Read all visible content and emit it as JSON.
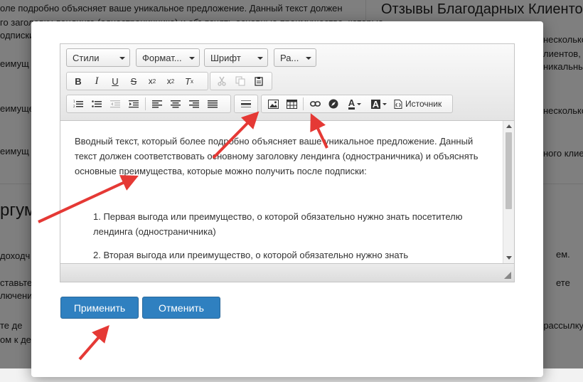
{
  "background": {
    "left_lines": [
      "оле подробно объясняет ваше уникальное предложение. Данный текст должен",
      "го заголовку лендинга (одностраничника) и объяснять основные преимущества, которые",
      "одписки:",
      "еимущ",
      "еимуще",
      "еимущ"
    ],
    "right_heading": "Отзывы Благодарных Клиенто",
    "right_lines": [
      "несколько",
      "лиентов,",
      "никальным",
      "несколько",
      "ного клиен"
    ],
    "left_big": "ргум",
    "lower_left_lines": [
      "доходч",
      "ставьте ч",
      "лючение",
      "те де",
      "ом к де"
    ],
    "lower_right_lines": [
      "ем.",
      "ете",
      "-рассылку"
    ]
  },
  "editor": {
    "toolbar": {
      "combos": [
        "Стили",
        "Формат...",
        "Шрифт",
        "Ра..."
      ],
      "source_label": "Источник"
    },
    "content": {
      "intro": "Вводный текст, который более подробно объясняет ваше уникальное предложение. Данный текст должен соответствовать основному заголовку лендинга (одностраничника) и объяснять основные преимущества, которые можно получить после подписки:",
      "list": [
        "1. Первая выгода или преимущество, о которой обязательно нужно знать посетителю лендинга (одностраничника)",
        "2. Вторая выгода или преимущество, о которой обязательно нужно знать"
      ]
    }
  },
  "buttons": {
    "apply": "Применить",
    "cancel": "Отменить"
  },
  "colors": {
    "primary_button": "#2f80c0",
    "annotation_arrow": "#e53935"
  }
}
